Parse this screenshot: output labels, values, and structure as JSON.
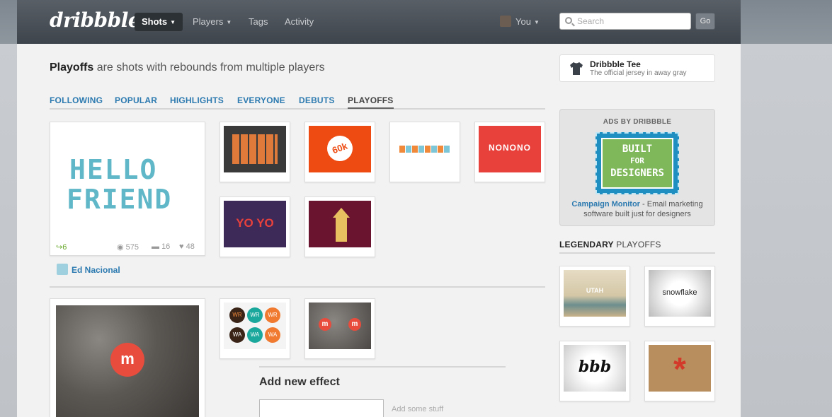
{
  "header": {
    "logo": "dribbble",
    "nav": [
      {
        "label": "Shots",
        "active": true,
        "dropdown": true
      },
      {
        "label": "Players",
        "active": false,
        "dropdown": true
      },
      {
        "label": "Tags",
        "active": false,
        "dropdown": false
      },
      {
        "label": "Activity",
        "active": false,
        "dropdown": false
      }
    ],
    "user_label": "You",
    "search_placeholder": "Search",
    "go_label": "Go"
  },
  "main": {
    "tagline_bold": "Playoffs",
    "tagline_rest": " are shots with rebounds from multiple players",
    "tabs": [
      "FOLLOWING",
      "POPULAR",
      "HIGHLIGHTS",
      "EVERYONE",
      "DEBUTS",
      "PLAYOFFS"
    ],
    "active_tab": "PLAYOFFS",
    "playoff1": {
      "title_lines": [
        "HELLO",
        "FRIEND"
      ],
      "rebounds": "6",
      "views": "575",
      "comments": "16",
      "likes": "48",
      "player": "Ed Nacional",
      "rebound_texts": [
        "NONONO",
        "YO YO",
        "60k"
      ]
    },
    "playoff2": {
      "badges": [
        "WR",
        "WR",
        "WR",
        "WA",
        "WA",
        "WA"
      ]
    },
    "add_effect": {
      "title": "Add new effect",
      "hint": "Add some stuff"
    }
  },
  "sidebar": {
    "tee_title": "Dribbble Tee",
    "tee_sub": "The official jersey in away gray",
    "ads_title": "ADS BY DRIBBBLE",
    "ad_lines": [
      "BUILT",
      "FOR",
      "DESIGNERS"
    ],
    "ad_link": "Campaign Monitor",
    "ad_text": " - Email marketing software built just for designers",
    "legend_bold": "LEGENDARY",
    "legend_rest": " PLAYOFFS",
    "legend_texts": [
      "UTAH",
      "snowflake",
      "bbb"
    ]
  },
  "colors": {
    "link": "#2c7ab0",
    "rebound": "#6aaa2e",
    "accent_red": "#e84c3d",
    "teal": "#5fb7c8"
  }
}
